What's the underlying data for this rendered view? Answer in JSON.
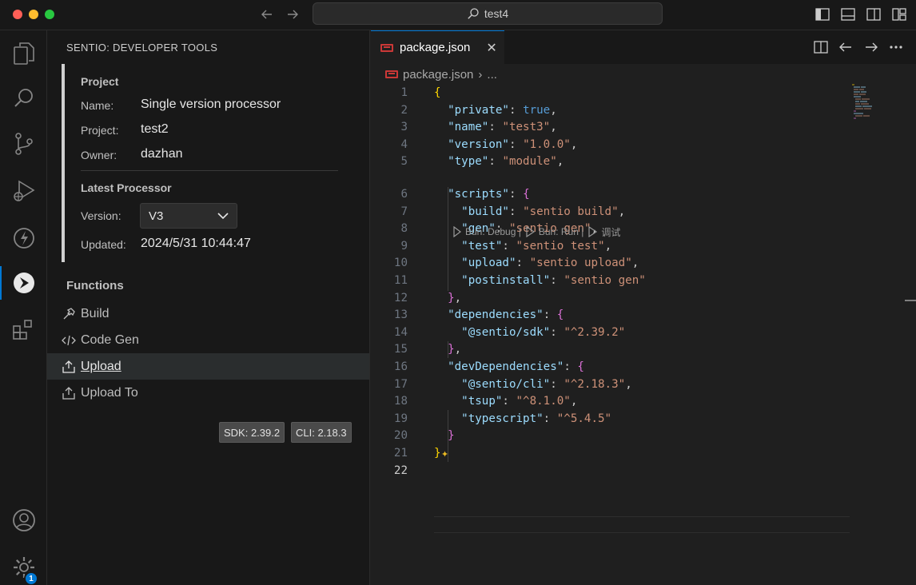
{
  "window": {
    "search_text": "test4"
  },
  "activity_bar": {
    "items": [
      "explorer",
      "search",
      "source-control",
      "run-and-debug",
      "lightning",
      "sentio",
      "extensions"
    ],
    "account": "account",
    "settings_badge": "1"
  },
  "sidebar": {
    "title": "SENTIO: DEVELOPER TOOLS",
    "project": {
      "heading": "Project",
      "name_label": "Name:",
      "name_value": "Single version processor",
      "project_label": "Project:",
      "project_value": "test2",
      "owner_label": "Owner:",
      "owner_value": "dazhan"
    },
    "latest_processor": {
      "heading": "Latest Processor",
      "version_label": "Version:",
      "version_value": "V3",
      "updated_label": "Updated:",
      "updated_value": "2024/5/31 10:44:47"
    },
    "functions": {
      "heading": "Functions",
      "items": [
        {
          "label": "Build",
          "icon": "hammer-icon"
        },
        {
          "label": "Code Gen",
          "icon": "code-icon"
        },
        {
          "label": "Upload",
          "icon": "upload-icon"
        },
        {
          "label": "Upload To",
          "icon": "upload-icon"
        }
      ],
      "selected_index": 2
    },
    "versions": {
      "sdk": "SDK: 2.39.2",
      "cli": "CLI: 2.18.3"
    }
  },
  "editor": {
    "tab_label": "package.json",
    "breadcrumb_file": "package.json",
    "breadcrumb_more": "...",
    "codelens": {
      "debug": "Bun: Debug |",
      "run": "Bun: Run |",
      "zh": "调试"
    },
    "current_line": 22,
    "lines": [
      "{",
      "  \"private\": true,",
      "  \"name\": \"test3\",",
      "  \"version\": \"1.0.0\",",
      "  \"type\": \"module\",",
      "  \"scripts\": {",
      "    \"build\": \"sentio build\",",
      "    \"gen\": \"sentio gen\",",
      "    \"test\": \"sentio test\",",
      "    \"upload\": \"sentio upload\",",
      "    \"postinstall\": \"sentio gen\"",
      "  },",
      "  \"dependencies\": {",
      "    \"@sentio/sdk\": \"^2.39.2\"",
      "  },",
      "  \"devDependencies\": {",
      "    \"@sentio/cli\": \"^2.18.3\",",
      "    \"tsup\": \"^8.1.0\",",
      "    \"typescript\": \"^5.4.5\"",
      "  }",
      "}",
      ""
    ]
  },
  "colors": {
    "accent": "#0078d4",
    "json_key": "#9cdcfe",
    "json_string": "#ce9178",
    "json_bool": "#569cd6",
    "bracket_gold": "#ffd700",
    "bracket_magenta": "#da70d6"
  }
}
